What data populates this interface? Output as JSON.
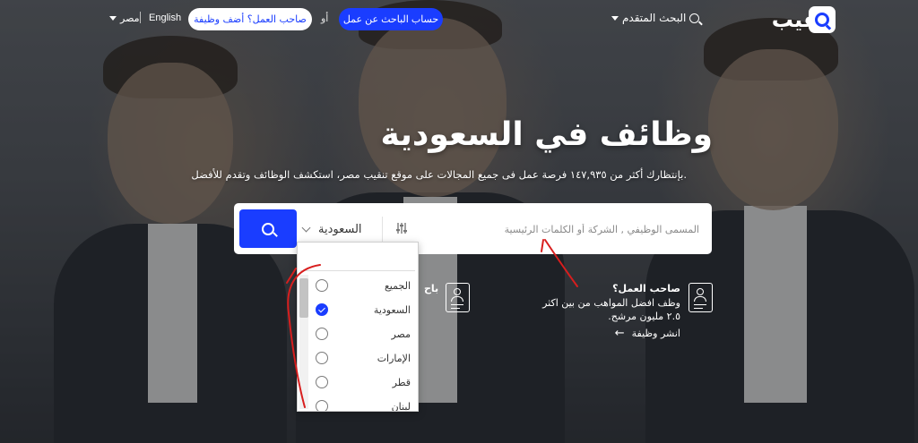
{
  "header": {
    "logo_text": "تنقيب",
    "logo_icon": "Q",
    "advanced_search": "البحث المتقدم",
    "seeker_button": "حساب الباحث عن عمل",
    "or": "أو",
    "employer_button": "صاحب العمل؟ أضف وظيفة",
    "lang_english": "English",
    "country": "مصر"
  },
  "hero": {
    "title": "وظائف في السعودية",
    "subtitle": "بإنتظارك أكثر من ١٤٧,٩٣٥ فرصة عمل فى جميع المجالات على موقع تنقيب مصر، استكشف الوظائف وتقدم للأفضل."
  },
  "search": {
    "placeholder": "المسمى الوظيفي , الشركة أو الكلمات الرئيسية",
    "value": "",
    "selected_country": "السعودية"
  },
  "dropdown": {
    "search_value": "",
    "items": [
      {
        "label": "الجميع",
        "checked": false
      },
      {
        "label": "السعودية",
        "checked": true
      },
      {
        "label": "مصر",
        "checked": false
      },
      {
        "label": "الإمارات",
        "checked": false
      },
      {
        "label": "قطر",
        "checked": false
      },
      {
        "label": "لبنان",
        "checked": false
      }
    ]
  },
  "employer_block": {
    "title": "صاحب العمل؟",
    "description": "وظف افضل المواهب من بين اكثر ٢.٥ مليون مرشح.",
    "link": "انشر وظيفة"
  },
  "seeker_block": {
    "title_partial": "باح",
    "lines_partial": [
      "ال",
      "ب",
      "و",
      "بنا"
    ]
  },
  "colors": {
    "primary": "#1a3dff",
    "annotation": "#d81e1e"
  },
  "icons": [
    "search-icon",
    "chevron-down-icon",
    "filter-sliders-icon",
    "employer-doc-icon",
    "seeker-doc-icon",
    "arrow-left-icon",
    "check-icon"
  ]
}
